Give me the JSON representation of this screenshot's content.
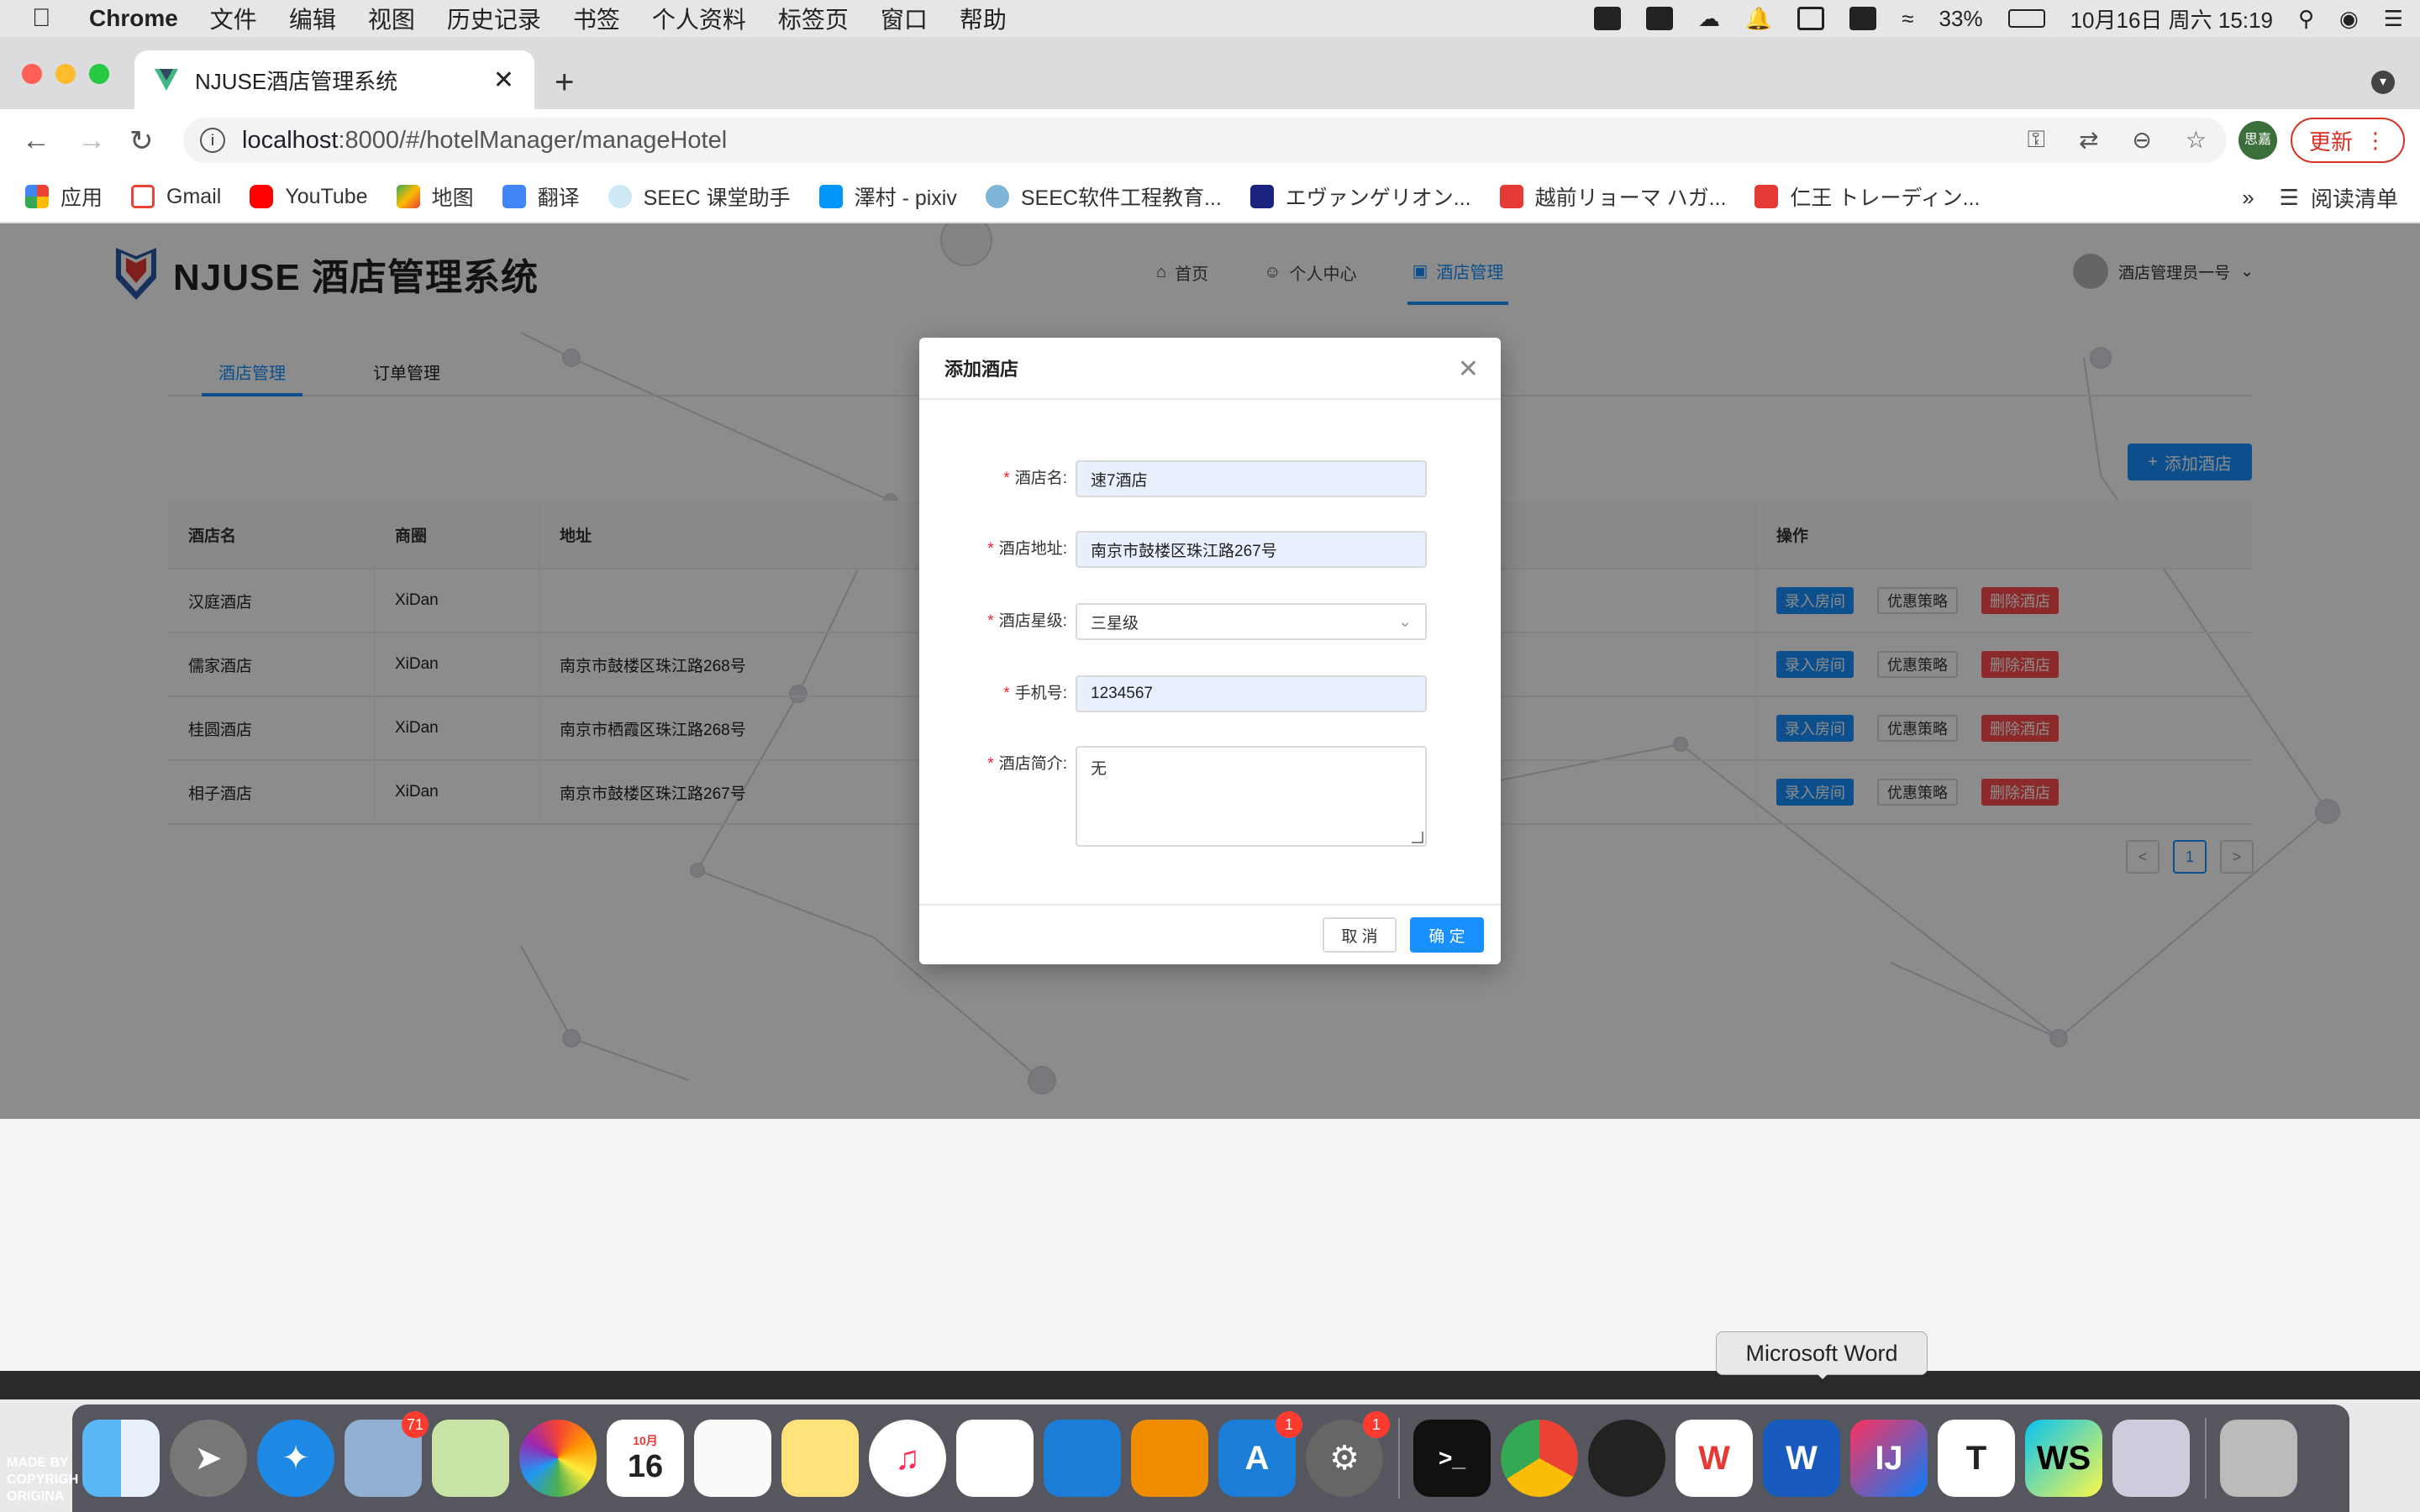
{
  "menubar": {
    "app": "Chrome",
    "items": [
      "文件",
      "编辑",
      "视图",
      "历史记录",
      "书签",
      "个人资料",
      "标签页",
      "窗口",
      "帮助"
    ],
    "battery": "33%",
    "datetime": "10月16日 周六 15:19"
  },
  "browser": {
    "tab_title": "NJUSE酒店管理系统",
    "url_host": "localhost",
    "url_path": ":8000/#/hotelManager/manageHotel",
    "profile_initials": "思嘉",
    "update_label": "更新",
    "bookmarks": [
      "应用",
      "Gmail",
      "YouTube",
      "地图",
      "翻译",
      "SEEC 课堂助手",
      "澤村 - pixiv",
      "SEEC软件工程教育...",
      "エヴァンゲリオン...",
      "越前リョーマ ハガ...",
      "仁王 トレーディン..."
    ],
    "reading_list": "阅读清单",
    "more": "»"
  },
  "app": {
    "system_title": "NJUSE 酒店管理系统",
    "nav": [
      {
        "label": "首页",
        "icon": "home-icon"
      },
      {
        "label": "个人中心",
        "icon": "user-icon"
      },
      {
        "label": "酒店管理",
        "icon": "hotel-icon"
      }
    ],
    "user_name": "酒店管理员一号",
    "sub_tabs": [
      "酒店管理",
      "订单管理"
    ],
    "add_hotel_label": "添加酒店",
    "table": {
      "headers": [
        "酒店名",
        "商圈",
        "地址",
        "操作"
      ],
      "rows": [
        {
          "name": "汉庭酒店",
          "area": "XiDan",
          "address": ""
        },
        {
          "name": "儒家酒店",
          "area": "XiDan",
          "address": "南京市鼓楼区珠江路268号"
        },
        {
          "name": "桂圆酒店",
          "area": "XiDan",
          "address": "南京市栖霞区珠江路268号"
        },
        {
          "name": "相子酒店",
          "area": "XiDan",
          "address": "南京市鼓楼区珠江路267号"
        }
      ],
      "actions": [
        "录入房间",
        "优惠策略",
        "删除酒店"
      ]
    },
    "pagination": {
      "current": "1",
      "prev": "<",
      "next": ">"
    }
  },
  "modal": {
    "title": "添加酒店",
    "fields": {
      "name_label": "酒店名",
      "name_value": "速7酒店",
      "address_label": "酒店地址",
      "address_value": "南京市鼓楼区珠江路267号",
      "star_label": "酒店星级",
      "star_value": "三星级",
      "phone_label": "手机号",
      "phone_value": "1234567",
      "intro_label": "酒店简介",
      "intro_value": "无"
    },
    "cancel_label": "取 消",
    "ok_label": "确 定"
  },
  "dock": {
    "tooltip": "Microsoft Word",
    "mail_badge": "71",
    "appstore_badge": "1",
    "prefs_badge": "1",
    "calendar_month": "10月",
    "calendar_day": "16",
    "made_by": "MADE BY\nCOPYRIGH\nORIGINA"
  },
  "colors": {
    "primary": "#1890ff",
    "danger": "#ff4d4f",
    "required": "#f5222d"
  }
}
